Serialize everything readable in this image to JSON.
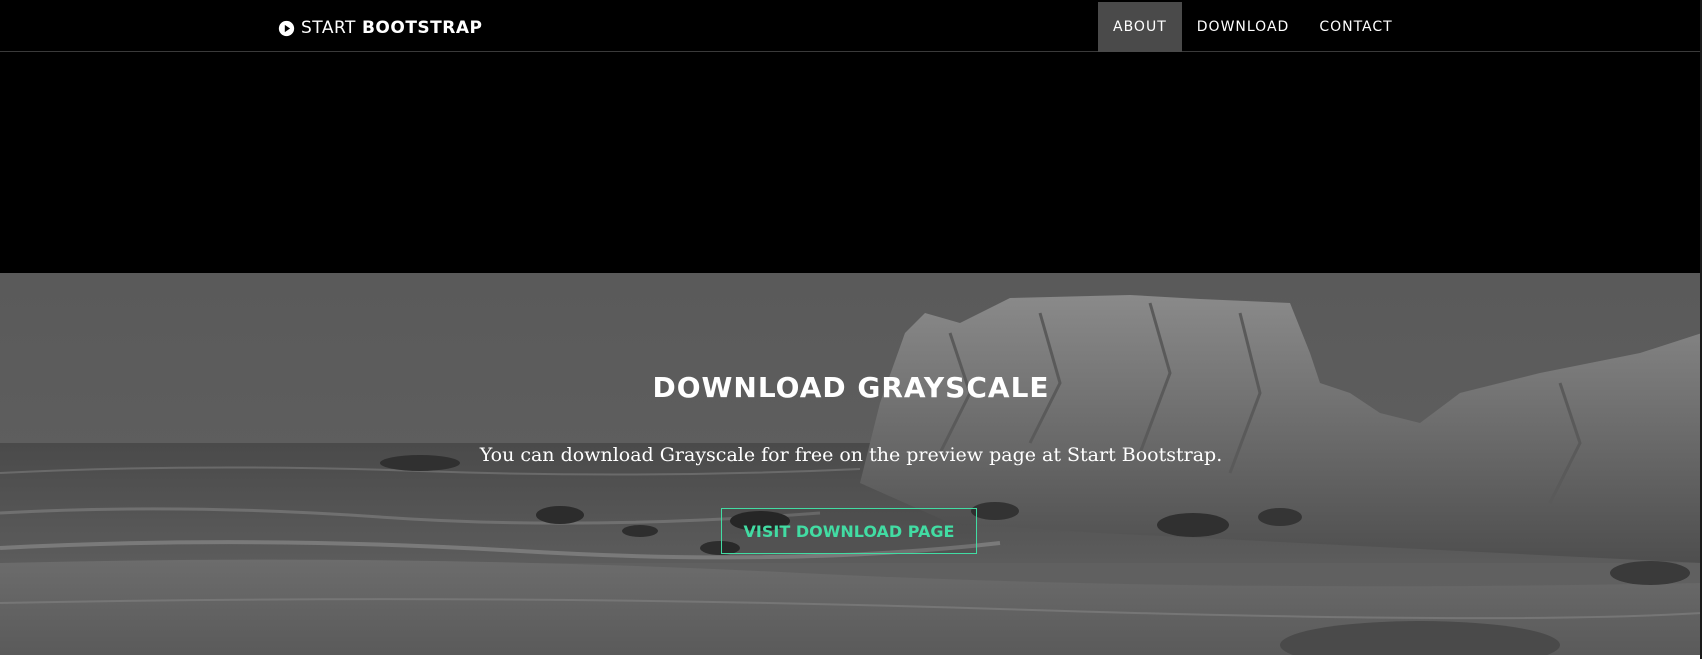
{
  "navbar": {
    "brand_light": "START",
    "brand_bold": "BOOTSTRAP",
    "brand_icon": "play-circle-icon",
    "items": [
      {
        "label": "ABOUT",
        "active": true
      },
      {
        "label": "DOWNLOAD",
        "active": false
      },
      {
        "label": "CONTACT",
        "active": false
      }
    ]
  },
  "download": {
    "title": "DOWNLOAD GRAYSCALE",
    "text": "You can download Grayscale for free on the preview page at Start Bootstrap.",
    "button_label": "VISIT DOWNLOAD PAGE",
    "background": "grayscale-beach-rocks-photo"
  },
  "colors": {
    "page_background": "#000000",
    "navbar_background": "#000000",
    "nav_active_background": "#4a4a4a",
    "accent": "#42dca3",
    "text": "#ffffff"
  }
}
